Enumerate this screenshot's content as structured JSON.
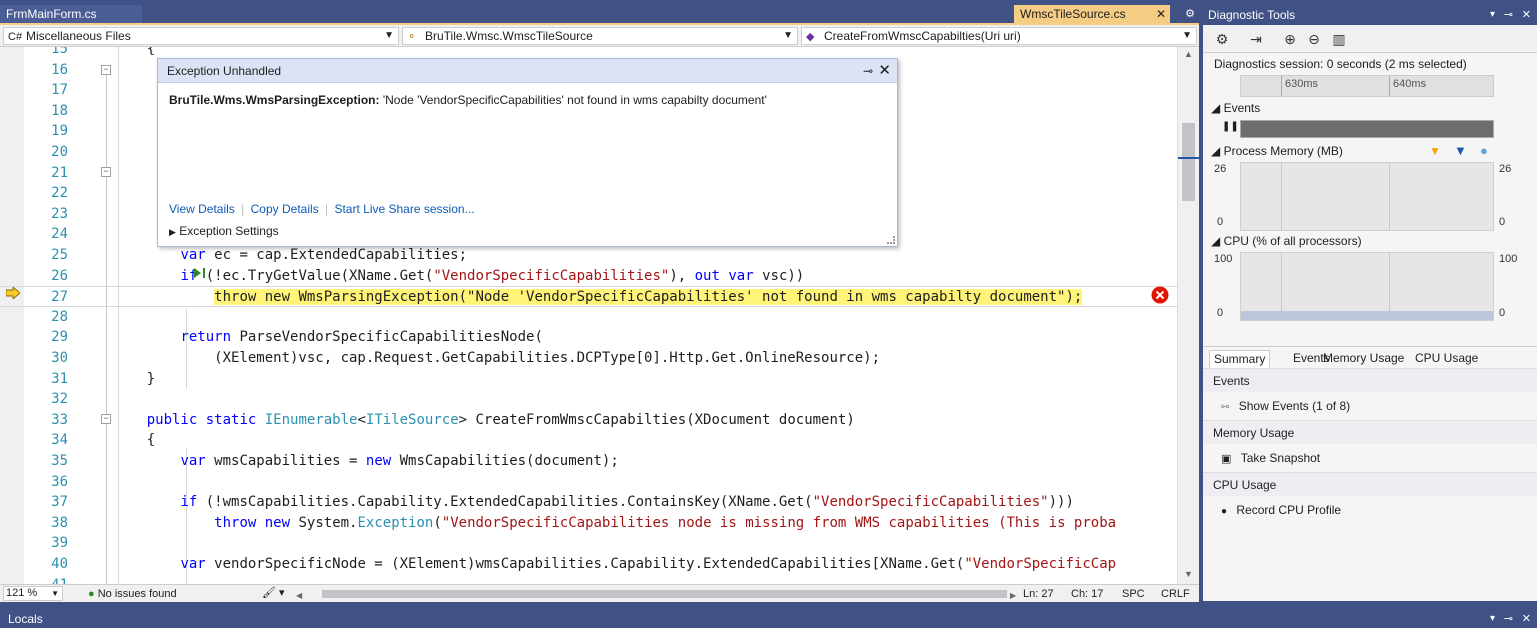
{
  "tabs": {
    "inactive_tab": "FrmMainForm.cs",
    "active_tab": "WmscTileSource.cs",
    "close_glyph": "✕",
    "pin_glyph": "▾"
  },
  "nav": {
    "project": "Miscellaneous Files",
    "class": "BruTile.Wmsc.WmscTileSource",
    "member": "CreateFromWmscCapabilties(Uri uri)"
  },
  "code_lines": [
    {
      "n": "15",
      "t": "    {"
    },
    {
      "n": "16",
      "t": ""
    },
    {
      "n": "17",
      "t": ""
    },
    {
      "n": "18",
      "t": ""
    },
    {
      "n": "19",
      "t": ""
    },
    {
      "n": "20",
      "t": ""
    },
    {
      "n": "21",
      "t": ""
    },
    {
      "n": "22",
      "t": ""
    },
    {
      "n": "23",
      "t": ""
    },
    {
      "n": "24",
      "t": ""
    },
    {
      "n": "25",
      "t": "        var ec = cap.ExtendedCapabilities;"
    },
    {
      "n": "26",
      "t": "        if (!ec.TryGetValue(XName.Get(\"VendorSpecificCapabilities\"), out var vsc))"
    },
    {
      "n": "27",
      "t": "            throw new WmsParsingException(\"Node 'VendorSpecificCapabilities' not found in wms capabilty document\");"
    },
    {
      "n": "28",
      "t": ""
    },
    {
      "n": "29",
      "t": "        return ParseVendorSpecificCapabilitiesNode("
    },
    {
      "n": "30",
      "t": "            (XElement)vsc, cap.Request.GetCapabilities.DCPType[0].Http.Get.OnlineResource);"
    },
    {
      "n": "31",
      "t": "    }"
    },
    {
      "n": "32",
      "t": ""
    },
    {
      "n": "33",
      "t": "    public static IEnumerable<ITileSource> CreateFromWmscCapabilties(XDocument document)"
    },
    {
      "n": "34",
      "t": "    {"
    },
    {
      "n": "35",
      "t": "        var wmsCapabilities = new WmsCapabilities(document);"
    },
    {
      "n": "36",
      "t": ""
    },
    {
      "n": "37",
      "t": "        if (!wmsCapabilities.Capability.ExtendedCapabilities.ContainsKey(XName.Get(\"VendorSpecificCapabilities\")))"
    },
    {
      "n": "38",
      "t": "            throw new System.Exception(\"VendorSpecificCapabilities node is missing from WMS capabilities (This is proba"
    },
    {
      "n": "39",
      "t": ""
    },
    {
      "n": "40",
      "t": "        var vendorSpecificNode = (XElement)wmsCapabilities.Capability.ExtendedCapabilities[XName.Get(\"VendorSpecificCap"
    },
    {
      "n": "41",
      "t": ""
    }
  ],
  "exception": {
    "title": "Exception Unhandled",
    "type": "BruTile.Wms.WmsParsingException:",
    "message": "'Node 'VendorSpecificCapabilities' not found in wms capabilty document'",
    "view_details": "View Details",
    "copy_details": "Copy Details",
    "live_share": "Start Live Share session...",
    "settings": "Exception Settings"
  },
  "status": {
    "zoom": "121 %",
    "issues": "No issues found",
    "ln": "Ln: 27",
    "ch": "Ch: 17",
    "spc": "SPC",
    "crlf": "CRLF"
  },
  "diag": {
    "title": "Diagnostic Tools",
    "session": "Diagnostics session: 0 seconds (2 ms selected)",
    "tick1": "630ms",
    "tick2": "640ms",
    "events_label": "Events",
    "memory_label": "Process Memory (MB)",
    "mem_max": "26",
    "mem_min": "0",
    "cpu_label": "CPU (% of all processors)",
    "cpu_max": "100",
    "cpu_min": "0",
    "tabs": [
      "Summary",
      "Events",
      "Memory Usage",
      "CPU Usage"
    ],
    "events_head": "Events",
    "show_events": "Show Events (1 of 8)",
    "memory_head": "Memory Usage",
    "take_snapshot": "Take Snapshot",
    "cpu_head": "CPU Usage",
    "record_cpu": "Record CPU Profile"
  },
  "locals": {
    "title": "Locals"
  },
  "colors": {
    "chrome": "#3f5185",
    "active_tab": "#f5cc84",
    "highlight": "#fff478",
    "keyword": "#0000ff",
    "type": "#2b91af",
    "string": "#a31515",
    "link": "#0e5cba",
    "error": "#e51400"
  }
}
